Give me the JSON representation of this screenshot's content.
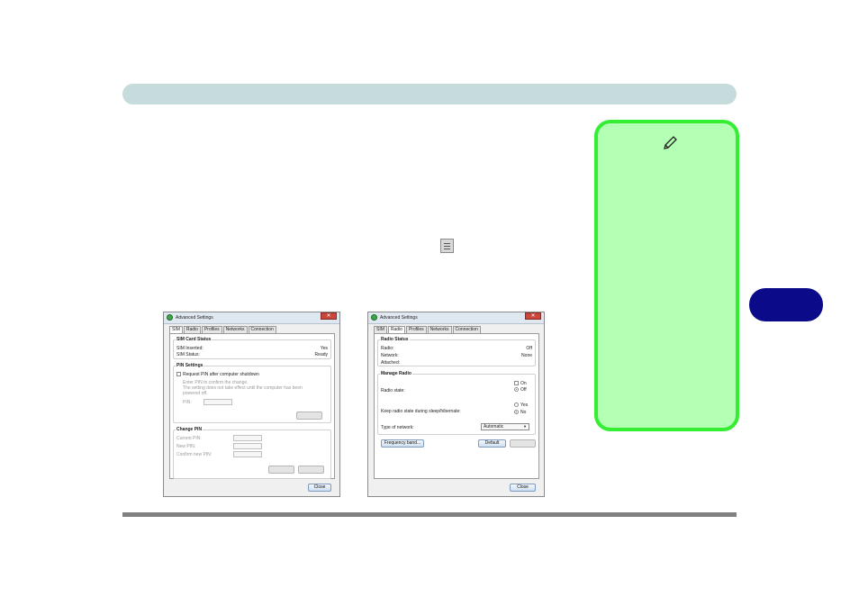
{
  "window1": {
    "title": "Advanced Settings",
    "tabs": [
      "SIM",
      "Radio",
      "Profiles",
      "Networks",
      "Connection"
    ],
    "active_tab": "SIM",
    "sim_card_status": {
      "heading": "SIM Card Status",
      "rows": [
        {
          "label": "SIM Inserted:",
          "value": "Yes"
        },
        {
          "label": "SIM Status:",
          "value": "Ready"
        }
      ]
    },
    "pin_settings": {
      "heading": "PIN Settings",
      "checkbox_label": "Request PIN after computer shutdown",
      "desc_line1": "Enter PIN to confirm the change.",
      "desc_line2": "The setting does not take effect until the computer has been",
      "desc_line3": "powered off.",
      "pin_label": "PIN:"
    },
    "change_pin": {
      "heading": "Change PIN",
      "current_label": "Current PIN:",
      "new_label": "New PIN:",
      "confirm_label": "Confirm new PIN:"
    },
    "close_label": "Close"
  },
  "window2": {
    "title": "Advanced Settings",
    "tabs": [
      "SIM",
      "Radio",
      "Profiles",
      "Networks",
      "Connection"
    ],
    "active_tab": "Radio",
    "radio_status": {
      "heading": "Radio Status",
      "rows": [
        {
          "label": "Radio:",
          "value": "Off"
        },
        {
          "label": "Network:",
          "value": "None"
        },
        {
          "label": "Attached:",
          "value": ""
        }
      ]
    },
    "manage_radio": {
      "heading": "Manage Radio",
      "radio_state_label": "Radio state:",
      "radio_state_options": [
        "On",
        "Off"
      ],
      "radio_state_selected": "Off",
      "keep_state_label": "Keep radio state during sleep/hibernate:",
      "keep_state_options": [
        "Yes",
        "No"
      ],
      "keep_state_selected": "No",
      "network_type_label": "Type of network:",
      "network_type_value": "Automatic"
    },
    "frequency_band_label": "Frequency band...",
    "default_label": "Default",
    "close_label": "Close"
  },
  "colors": {
    "header_bar": "#c6dcdc",
    "note_border": "#33ee33",
    "note_fill": "#b3ffb3",
    "side_tab": "#0b0b8a"
  },
  "icons": [
    "pencil-icon",
    "settings-icon",
    "app-icon",
    "close-icon"
  ]
}
